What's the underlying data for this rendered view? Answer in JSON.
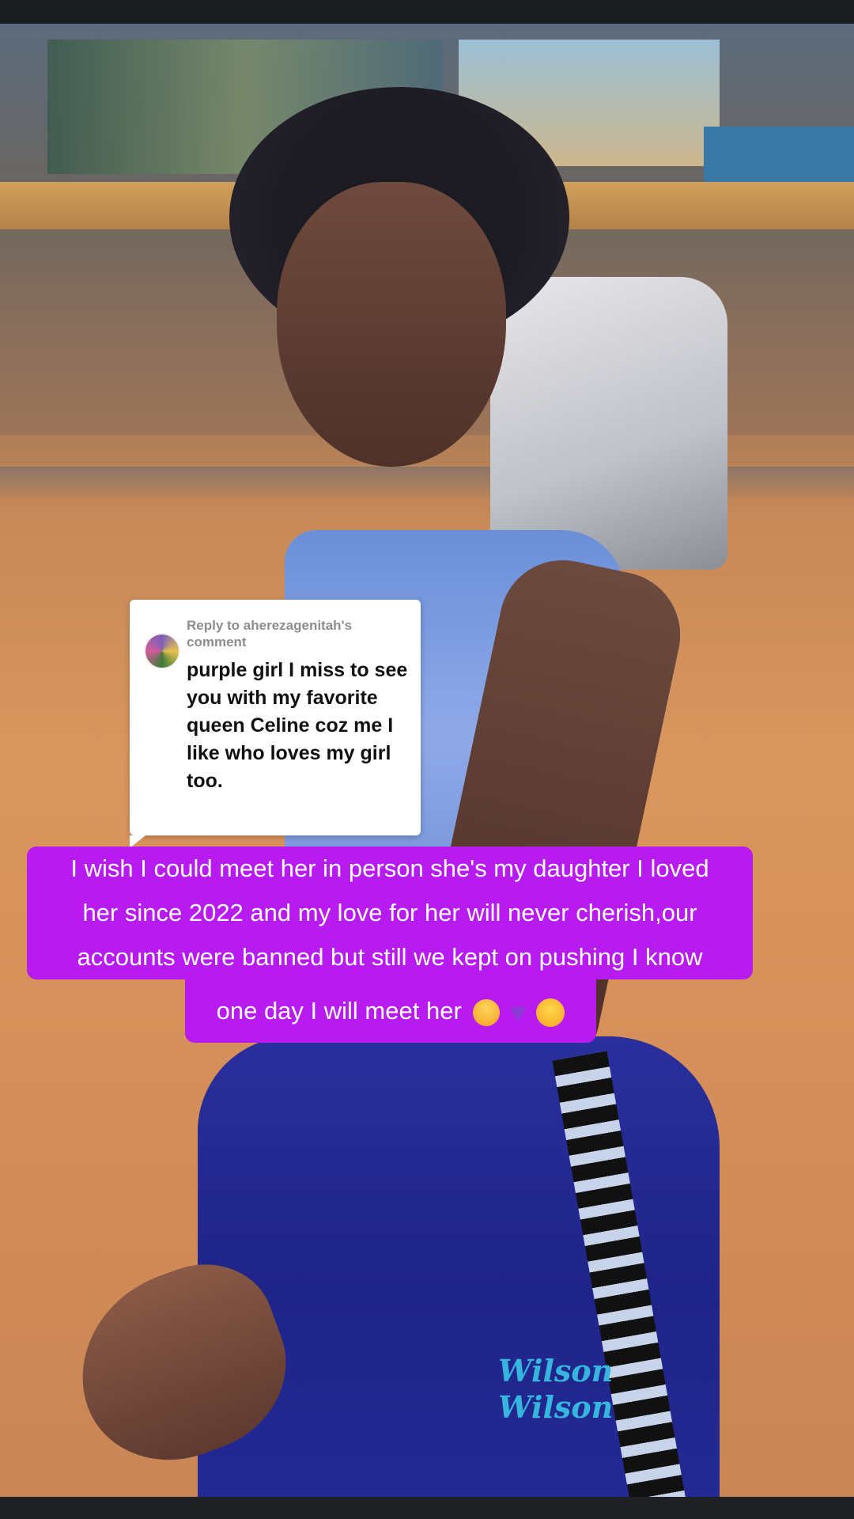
{
  "reply_card": {
    "header": "Reply to aherezagenitah's comment",
    "body": "purple girl I miss to see you with my favorite queen Celine coz me I like who loves my girl too."
  },
  "caption": {
    "line1": "I wish I could meet her in person she's my daughter I loved",
    "line2": "her since 2022 and my love for her will never cherish,our",
    "line3": "accounts were banned but still we kept on pushing I know",
    "line4": "one day I will meet her",
    "emojis": [
      "pray-icon",
      "purple-heart-icon",
      "weary-face-icon"
    ]
  },
  "video": {
    "pants_brand_line1": "Wilson",
    "pants_brand_line2": "Wilson"
  },
  "colors": {
    "caption_bg": "#b81bf0",
    "caption_text": "#ffffff",
    "reply_bg": "#ffffff",
    "reply_header": "#8d8d8d",
    "reply_text": "#111111"
  }
}
